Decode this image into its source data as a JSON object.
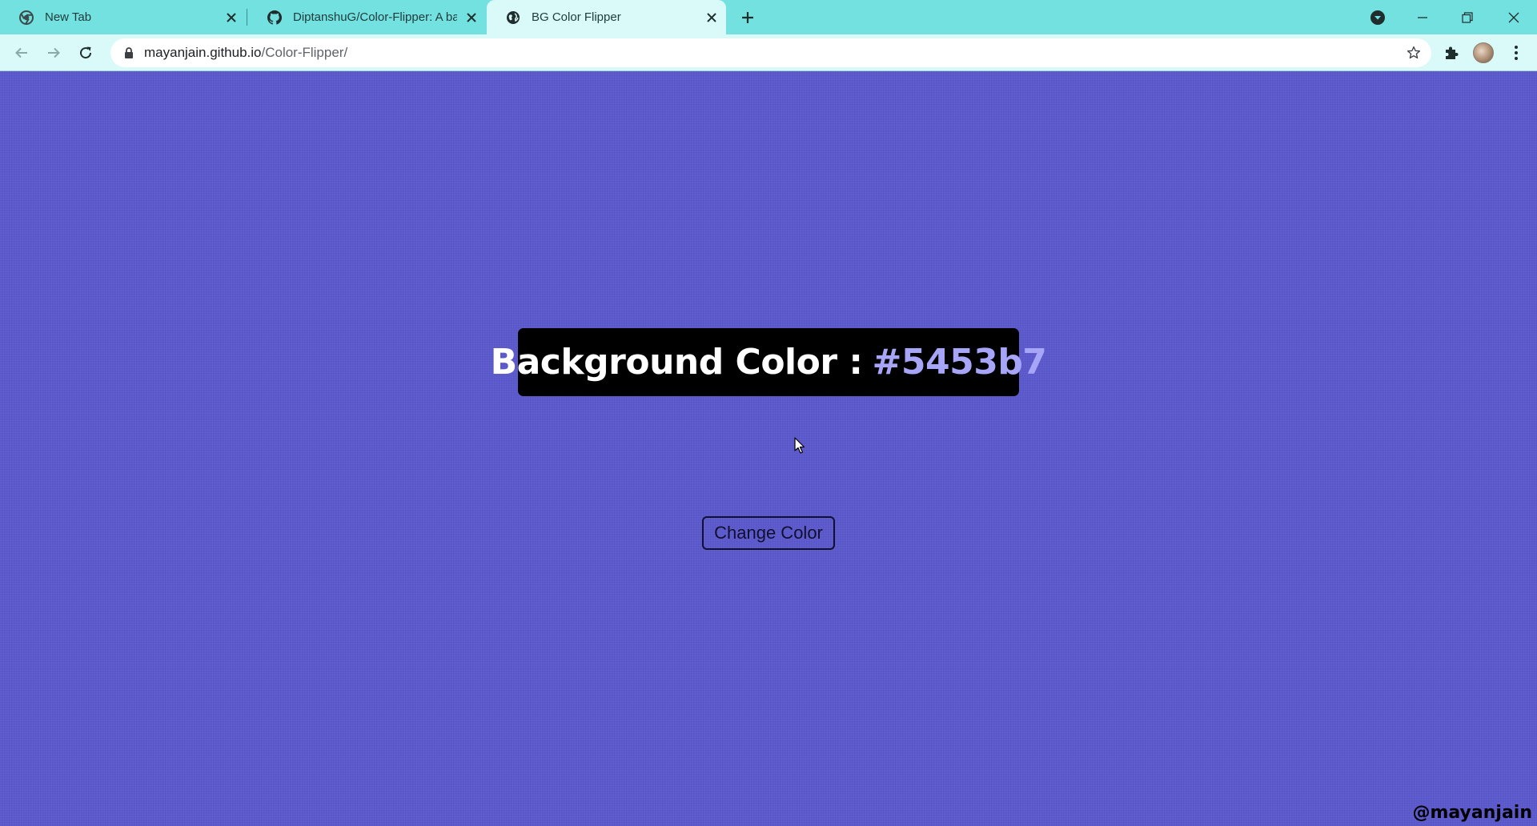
{
  "tabs": [
    {
      "title": "New Tab",
      "icon": "chrome-icon",
      "active": false
    },
    {
      "title": "DiptanshuG/Color-Flipper: A bac",
      "icon": "github-icon",
      "active": false
    },
    {
      "title": "BG Color Flipper",
      "icon": "globe-icon",
      "active": true
    }
  ],
  "address_bar": {
    "host": "mayanjain.github.io",
    "path": "/Color-Flipper/"
  },
  "page": {
    "background_color": "#5c5acd",
    "banner_label": "Background Color :",
    "banner_hex": "#5453b7",
    "hex_text_color": "#a7a5f7",
    "button_label": "Change Color",
    "watermark": "@mayanjain"
  },
  "colors": {
    "tabstrip": "#72e1df",
    "active_tab": "#d9faf9"
  }
}
